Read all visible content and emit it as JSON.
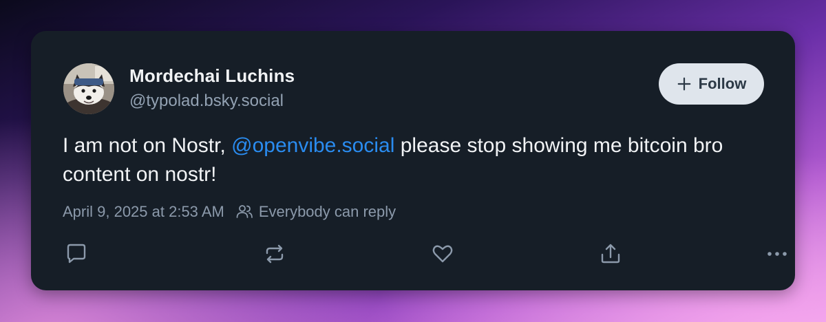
{
  "post": {
    "author": {
      "display_name": "Mordechai Luchins",
      "handle": "@typolad.bsky.social",
      "avatar_icon": "husky-dog-avatar"
    },
    "follow_button": {
      "label": "Follow",
      "icon": "plus-icon"
    },
    "text": {
      "before_mention": "I am not on Nostr, ",
      "mention": "@openvibe.social",
      "after_mention": " please stop showing me bitcoin bro content on nostr!"
    },
    "timestamp": "April 9, 2025 at 2:53 AM",
    "reply_setting": {
      "icon": "people-icon",
      "label": "Everybody can reply"
    },
    "actions": [
      {
        "name": "reply",
        "icon": "comment-icon"
      },
      {
        "name": "repost",
        "icon": "repost-icon"
      },
      {
        "name": "like",
        "icon": "heart-icon"
      },
      {
        "name": "share",
        "icon": "share-icon"
      },
      {
        "name": "more",
        "icon": "more-options-icon"
      }
    ]
  },
  "colors": {
    "card_background": "#161e27",
    "primary_text": "#f1f3f5",
    "secondary_text": "#93a2b3",
    "mention_link": "#2a8cf0",
    "follow_button_bg": "#dfe5ec",
    "follow_button_text": "#2c3946",
    "icon_color": "#8c9aab"
  }
}
